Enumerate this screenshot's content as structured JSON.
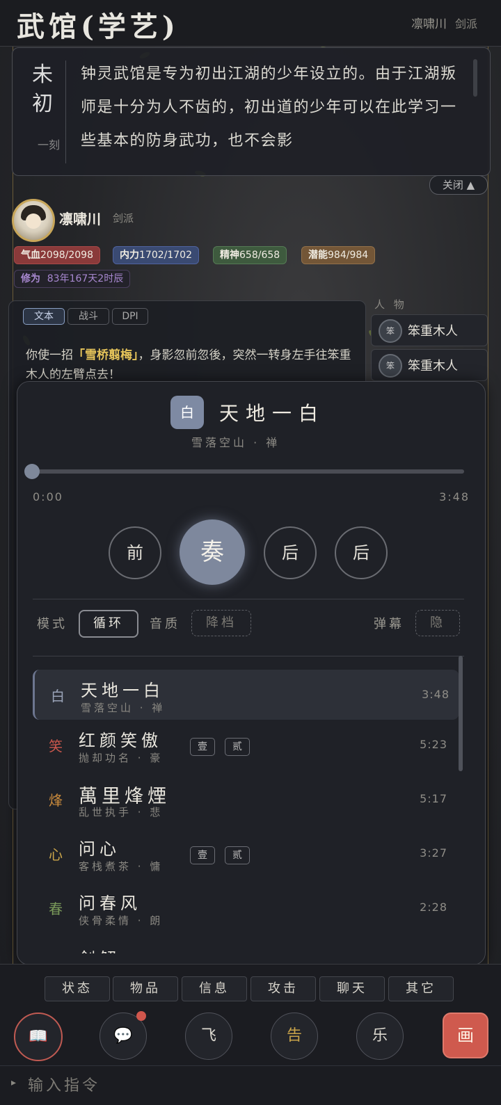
{
  "header": {
    "title": "武馆(学艺)",
    "username": "凛啸川",
    "sect": "剑派"
  },
  "narration": {
    "time_main": "未初",
    "time_sub": "一刻",
    "text": "钟灵武馆是专为初出江湖的少年设立的。由于江湖叛师是十分为人不齿的，初出道的少年可以在此学习一些基本的防身武功，也不会影",
    "close_label": "关闭 ▲"
  },
  "character": {
    "name": "凛啸川",
    "sect": "剑派",
    "stats": {
      "hp_label": "气血",
      "hp_value": "2098/2098",
      "mp_label": "内力",
      "mp_value": "1702/1702",
      "sp_label": "精神",
      "sp_value": "658/658",
      "pot_label": "潜能",
      "pot_value": "984/984",
      "cult_label": "修为",
      "cult_value": "83年167天2时辰"
    }
  },
  "log": {
    "tabs": [
      "文本",
      "战斗",
      "DPI"
    ],
    "line_pre": "你使一招",
    "line_skill": "「雪桥翦梅」",
    "line_post": "，身影忽前忽後，突然一转身左手往笨重木人的左臂点去！"
  },
  "people": {
    "label": "人 物",
    "items": [
      {
        "icon": "笨",
        "name": "笨重木人"
      },
      {
        "icon": "笨",
        "name": "笨重木人"
      }
    ]
  },
  "player": {
    "now_playing": {
      "icon": "白",
      "title": "天地一白",
      "artist": "雪落空山 · 禅"
    },
    "progress": 0,
    "time_current": "0:00",
    "time_total": "3:48",
    "controls": {
      "prev": "前",
      "play": "奏",
      "next": "后",
      "list": "后"
    },
    "options": {
      "mode_label": "模式",
      "mode_value": "循环",
      "quality_label": "音质",
      "quality_value": "降档",
      "danmaku_label": "弹幕",
      "danmaku_value": "隐"
    },
    "playlist": [
      {
        "icon": "白",
        "icon_color": "#9aa3b8",
        "title": "天地一白",
        "sub": "雪落空山 · 禅",
        "duration": "3:48",
        "tags": []
      },
      {
        "icon": "笑",
        "icon_color": "#c9574c",
        "title": "红颜笑傲",
        "sub": "抛却功名 · 豪",
        "duration": "5:23",
        "tags": [
          "壹",
          "贰"
        ]
      },
      {
        "icon": "烽",
        "icon_color": "#c98a3c",
        "title": "萬里烽煙",
        "sub": "乱世执手 · 悲",
        "duration": "5:17",
        "tags": []
      },
      {
        "icon": "心",
        "icon_color": "#c9a44a",
        "title": "问心",
        "sub": "客栈煮茶 · 慵",
        "duration": "3:27",
        "tags": [
          "壹",
          "贰"
        ]
      },
      {
        "icon": "春",
        "icon_color": "#7a9a5a",
        "title": "问春风",
        "sub": "侠骨柔情 · 朗",
        "duration": "2:28",
        "tags": []
      },
      {
        "icon": "剑",
        "icon_color": "#7a9a5a",
        "title": "剑解",
        "sub": "",
        "duration": "",
        "tags": []
      }
    ]
  },
  "commands": [
    "状态",
    "物品",
    "信息",
    "攻击",
    "聊天",
    "其它"
  ],
  "bottom_buttons": {
    "book": "📖",
    "chat": "💬",
    "fly": "飞",
    "notice": "告",
    "music": "乐",
    "paint": "画"
  },
  "input": {
    "placeholder": "输入指令"
  },
  "colors": {
    "accent_gold": "#c8a659",
    "hp": "#8a3a3a",
    "mp": "#3a4a72",
    "sp": "#3e5a3e",
    "pot": "#735637",
    "play_button": "#7e889d",
    "paint_button": "#cf5a4e"
  }
}
